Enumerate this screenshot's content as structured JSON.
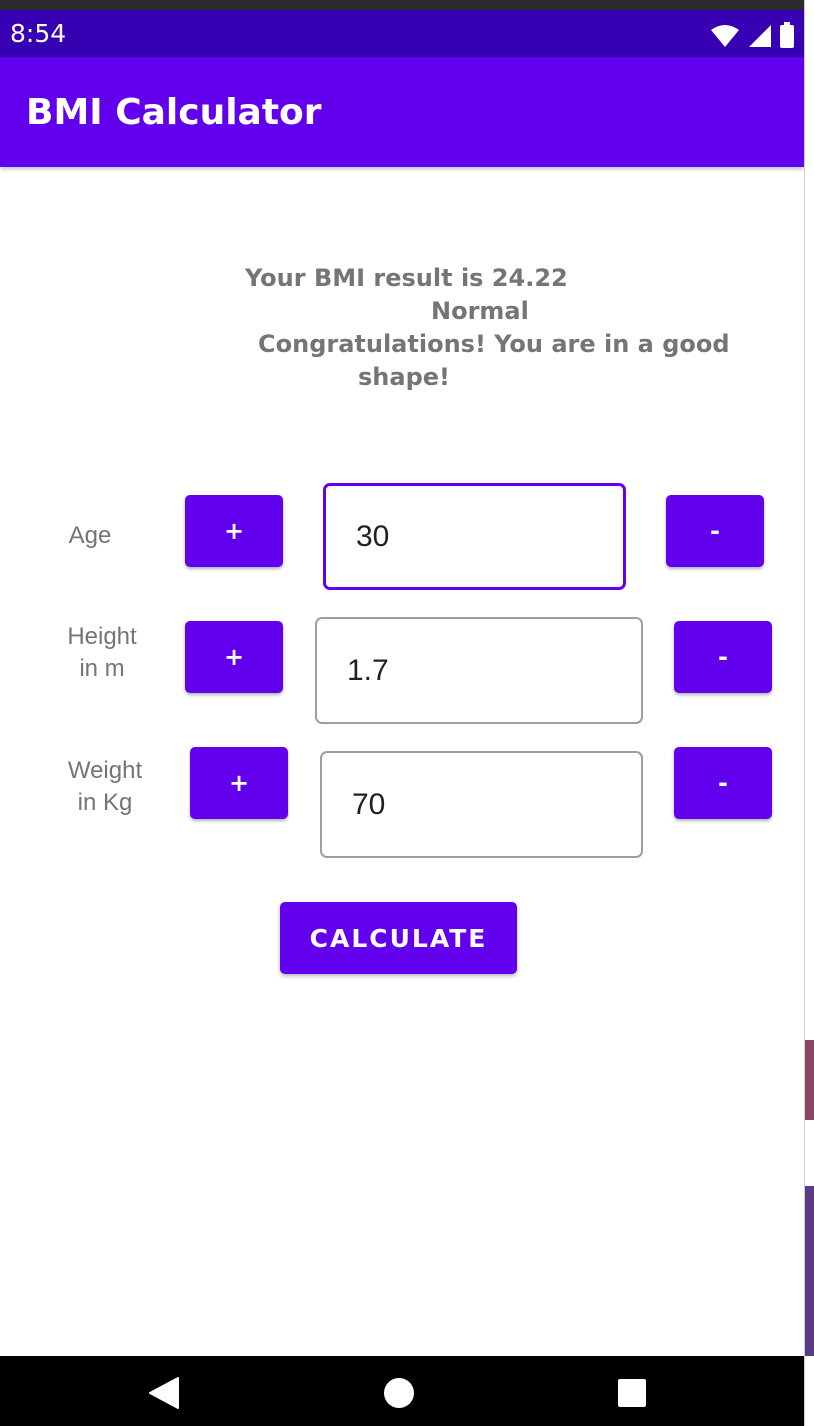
{
  "status_bar": {
    "time": "8:54"
  },
  "app_bar": {
    "title": "BMI Calculator"
  },
  "result": {
    "line1": "Your BMI result is 24.22",
    "line2": "Normal",
    "line3": "Congratulations! You are in a good",
    "line4": "shape!"
  },
  "rows": {
    "age": {
      "label": "Age",
      "value": "30",
      "plus": "+",
      "minus": "-"
    },
    "height": {
      "label_line1": "Height",
      "label_line2": "in m",
      "value": "1.7",
      "plus": "+",
      "minus": "-"
    },
    "weight": {
      "label_line1": "Weight",
      "label_line2": "in Kg",
      "value": "70",
      "plus": "+",
      "minus": "-"
    }
  },
  "calculate_label": "CALCULATE",
  "colors": {
    "primary": "#6200ee",
    "status_bar": "#3700b3",
    "text_gray": "#757575"
  },
  "icons": {
    "status": [
      "wifi-icon",
      "signal-icon",
      "battery-icon"
    ],
    "nav": [
      "back-icon",
      "home-icon",
      "recents-icon"
    ]
  }
}
